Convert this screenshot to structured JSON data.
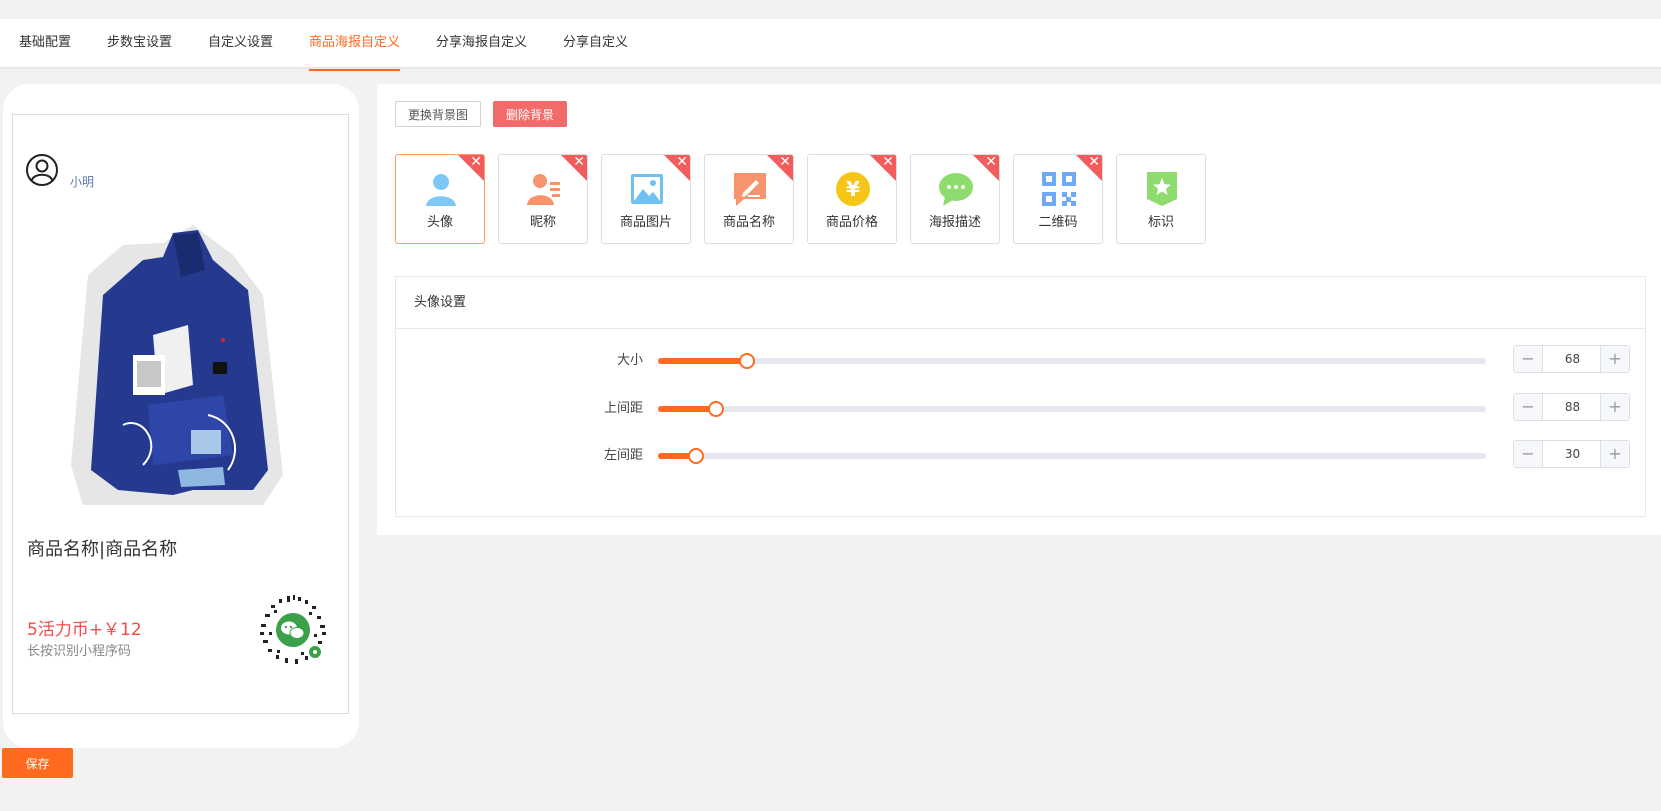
{
  "tabs": [
    {
      "label": "基础配置",
      "active": false
    },
    {
      "label": "步数宝设置",
      "active": false
    },
    {
      "label": "自定义设置",
      "active": false
    },
    {
      "label": "商品海报自定义",
      "active": true
    },
    {
      "label": "分享海报自定义",
      "active": false
    },
    {
      "label": "分享自定义",
      "active": false
    }
  ],
  "preview": {
    "nickname": "小明",
    "product_title": "商品名称|商品名称",
    "price": "5活力币+￥12",
    "hint": "长按识别小程序码"
  },
  "save_label": "保存",
  "toolbar": {
    "replace_bg": "更换背景图",
    "delete_bg": "删除背景"
  },
  "elements": [
    {
      "label": "头像",
      "icon": "avatar-icon",
      "color": "#7ec8f5",
      "selected": true,
      "deletable": true
    },
    {
      "label": "昵称",
      "icon": "nickname-icon",
      "color": "#f7946b",
      "selected": false,
      "deletable": true
    },
    {
      "label": "商品图片",
      "icon": "image-icon",
      "color": "#6cc3f2",
      "selected": false,
      "deletable": true
    },
    {
      "label": "商品名称",
      "icon": "edit-icon",
      "color": "#f7946b",
      "selected": false,
      "deletable": true
    },
    {
      "label": "商品价格",
      "icon": "yen-icon",
      "color": "#f5c518",
      "selected": false,
      "deletable": true
    },
    {
      "label": "海报描述",
      "icon": "chat-icon",
      "color": "#8edb6e",
      "selected": false,
      "deletable": true
    },
    {
      "label": "二维码",
      "icon": "qrcode-icon",
      "color": "#6fa8f5",
      "selected": false,
      "deletable": true
    },
    {
      "label": "标识",
      "icon": "badge-icon",
      "color": "#8edb6e",
      "selected": false,
      "deletable": false
    }
  ],
  "settings": {
    "title": "头像设置",
    "rows": [
      {
        "label": "大小",
        "value": "68",
        "percent": 10.8
      },
      {
        "label": "上间距",
        "value": "88",
        "percent": 7
      },
      {
        "label": "左间距",
        "value": "30",
        "percent": 4.6
      }
    ]
  },
  "colors": {
    "accent": "#ff6a1f",
    "danger": "#f26b6b",
    "price": "#f44a4a"
  }
}
